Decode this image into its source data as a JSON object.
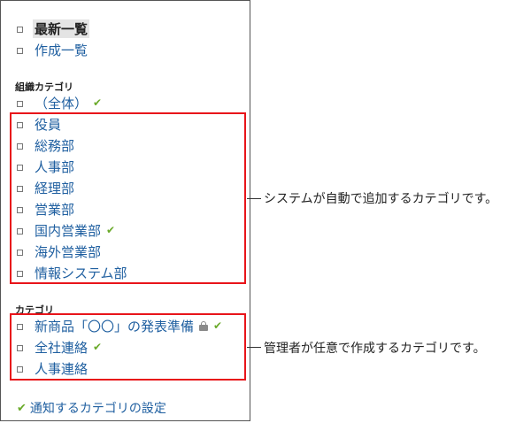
{
  "nav": {
    "top_items": [
      {
        "label": "最新一覧",
        "current": true
      },
      {
        "label": "作成一覧",
        "current": false
      }
    ],
    "org_section_title": "組織カテゴリ",
    "org_all": {
      "label": "（全体）",
      "notified": true
    },
    "org_items": [
      {
        "label": "役員",
        "notified": false
      },
      {
        "label": "総務部",
        "notified": false
      },
      {
        "label": "人事部",
        "notified": false
      },
      {
        "label": "経理部",
        "notified": false
      },
      {
        "label": "営業部",
        "notified": false
      },
      {
        "label": "国内営業部",
        "notified": true
      },
      {
        "label": "海外営業部",
        "notified": false
      },
      {
        "label": "情報システム部",
        "notified": false
      }
    ],
    "category_section_title": "カテゴリ",
    "category_items": [
      {
        "label": "新商品「〇〇」の発表準備",
        "locked": true,
        "notified": true
      },
      {
        "label": "全社連絡",
        "locked": false,
        "notified": true
      },
      {
        "label": "人事連絡",
        "locked": false,
        "notified": false
      }
    ],
    "footer_link": "通知するカテゴリの設定"
  },
  "annotations": {
    "system_categories": "システムが自動で追加するカテゴリです。",
    "admin_categories": "管理者が任意で作成するカテゴリです。"
  },
  "icons": {
    "bullet": "square-bullet-icon",
    "check": "check-icon",
    "lock": "lock-icon"
  },
  "colors": {
    "link": "#1f5fa0",
    "highlight_box": "#e8141a",
    "check": "#6aaa2a"
  }
}
